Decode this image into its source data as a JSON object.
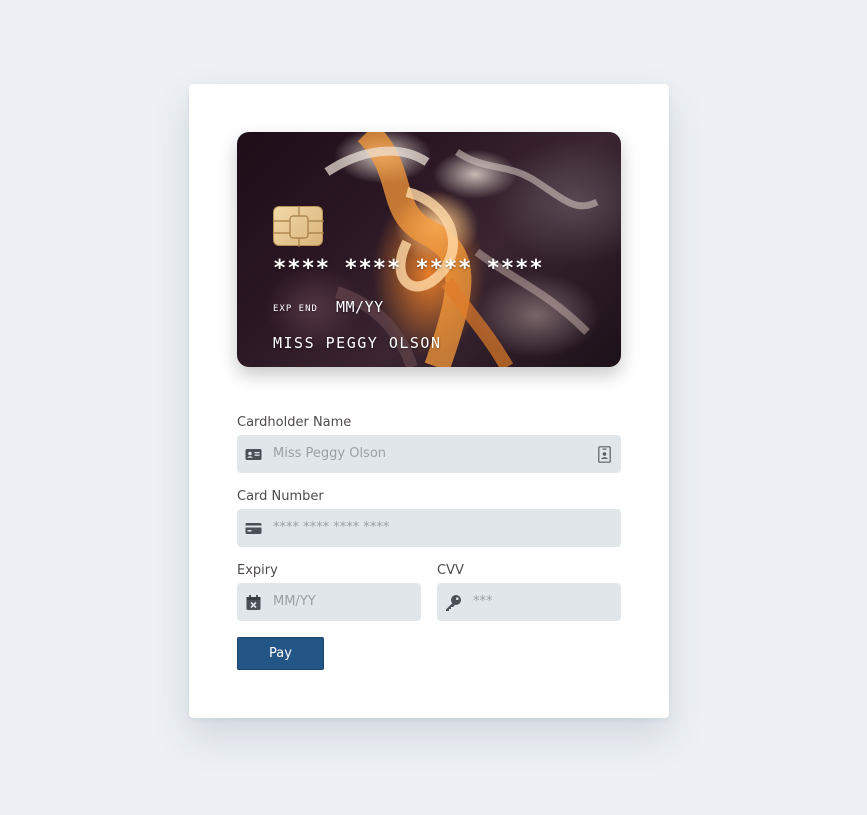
{
  "card": {
    "number": "**** **** **** ****",
    "exp_label": "EXP END",
    "exp_value": "MM/YY",
    "holder": "MISS PEGGY OLSON"
  },
  "form": {
    "cardholder": {
      "label": "Cardholder Name",
      "placeholder": "Miss Peggy Olson"
    },
    "number": {
      "label": "Card Number",
      "placeholder": "**** **** **** ****"
    },
    "expiry": {
      "label": "Expiry",
      "placeholder": "MM/YY"
    },
    "cvv": {
      "label": "CVV",
      "placeholder": "***"
    },
    "pay_label": "Pay"
  },
  "icons": {
    "name_field": "id-card-icon",
    "name_autofill": "contact-card-icon",
    "number_field": "credit-card-icon",
    "expiry_field": "calendar-icon",
    "cvv_field": "key-icon"
  },
  "colors": {
    "background": "#edf1f5",
    "field_background": "#e1e6ea",
    "pay_button": "#235586"
  }
}
